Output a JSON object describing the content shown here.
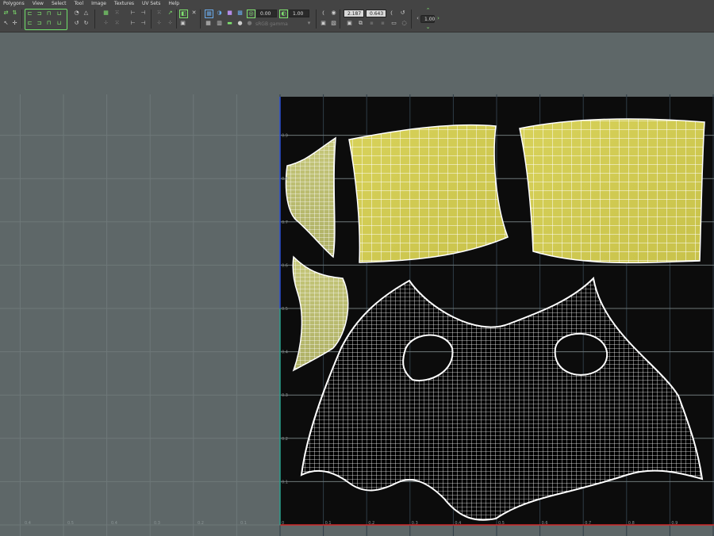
{
  "menu": [
    "Polygons",
    "View",
    "Select",
    "Tool",
    "Image",
    "Textures",
    "UV Sets",
    "Help"
  ],
  "toolbar": {
    "field_a": "0.00",
    "field_b": "1.00",
    "colorspace": "sRGB gamma",
    "coord_u": "2.187",
    "coord_v": "0.643",
    "zoom": "1.00"
  },
  "axis": {
    "u_ticks_left": [
      "0.4",
      "0.5",
      "0.4",
      "0.3",
      "0.2",
      "0.1"
    ],
    "u_ticks_right": [
      "0",
      "0.1",
      "0.2",
      "0.3",
      "0.4",
      "0.5",
      "0.6",
      "0.7",
      "0.8",
      "0.9"
    ],
    "v_ticks": [
      "0.9",
      "0.8",
      "0.7",
      "0.6",
      "0.5",
      "0.4",
      "0.3",
      "0.2",
      "0.1"
    ]
  },
  "colors": {
    "uv_fill": "#d8d25a",
    "uv_wire": "#ffffff",
    "tile_bg": "#0c0c0c",
    "grid": "#3b4a55",
    "u_axis": "#d22a2a",
    "v_axis": "#2a4fd2"
  }
}
